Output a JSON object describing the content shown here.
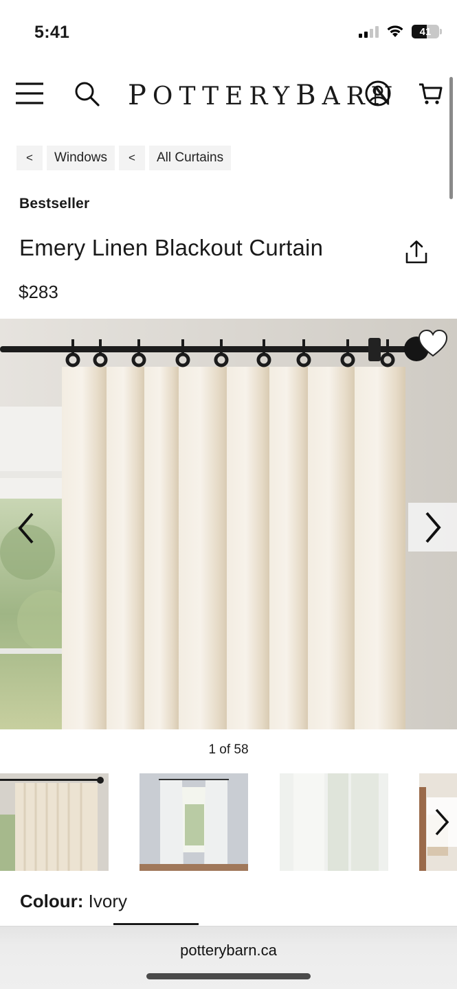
{
  "status_bar": {
    "time": "5:41",
    "battery": "41"
  },
  "header": {
    "brand": "POTTERYBARN"
  },
  "breadcrumbs": [
    {
      "arrow": "<",
      "label": "Windows"
    },
    {
      "arrow": "<",
      "label": "All Curtains"
    }
  ],
  "product": {
    "badge": "Bestseller",
    "title": "Emery Linen Blackout Curtain",
    "price": "$283",
    "image_counter": "1 of 58",
    "colour_label": "Colour:",
    "colour_value": "Ivory"
  },
  "browser": {
    "url": "potterybarn.ca"
  },
  "colors": {
    "text": "#1a1a1a",
    "chip_bg": "#f3f3f3",
    "curtain": "#efe6d6",
    "wall": "#d9d5cf"
  }
}
